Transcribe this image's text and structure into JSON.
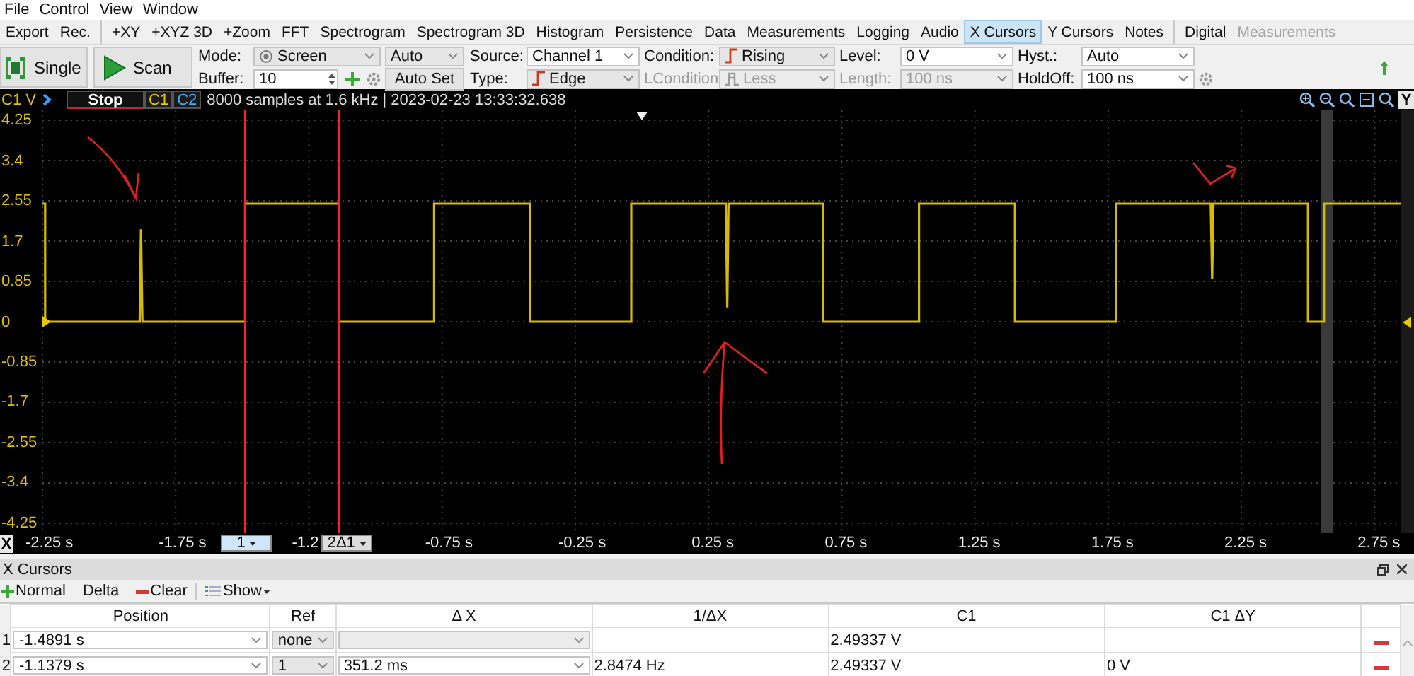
{
  "menu": [
    "File",
    "Control",
    "View",
    "Window"
  ],
  "tab_groups": [
    [
      {
        "label": "Export",
        "selected": false,
        "disabled": false
      },
      {
        "label": "Rec.",
        "selected": false,
        "disabled": false
      }
    ],
    [
      {
        "label": "+XY",
        "selected": false,
        "disabled": false
      },
      {
        "label": "+XYZ 3D",
        "selected": false,
        "disabled": false
      },
      {
        "label": "+Zoom",
        "selected": false,
        "disabled": false
      },
      {
        "label": "FFT",
        "selected": false,
        "disabled": false
      },
      {
        "label": "Spectrogram",
        "selected": false,
        "disabled": false
      },
      {
        "label": "Spectrogram 3D",
        "selected": false,
        "disabled": false
      },
      {
        "label": "Histogram",
        "selected": false,
        "disabled": false
      },
      {
        "label": "Persistence",
        "selected": false,
        "disabled": false
      },
      {
        "label": "Data",
        "selected": false,
        "disabled": false
      },
      {
        "label": "Measurements",
        "selected": false,
        "disabled": false
      },
      {
        "label": "Logging",
        "selected": false,
        "disabled": false
      },
      {
        "label": "Audio",
        "selected": false,
        "disabled": false
      },
      {
        "label": "X Cursors",
        "selected": true,
        "disabled": false
      },
      {
        "label": "Y Cursors",
        "selected": false,
        "disabled": false
      },
      {
        "label": "Notes",
        "selected": false,
        "disabled": false
      }
    ],
    [
      {
        "label": "Digital",
        "selected": false,
        "disabled": false
      },
      {
        "label": "Measurements",
        "selected": false,
        "disabled": true
      }
    ]
  ],
  "toolbar": {
    "single": "Single",
    "scan": "Scan",
    "mode_label": "Mode:",
    "mode": "Screen",
    "mode_option": "Auto",
    "buffer_label": "Buffer:",
    "buffer": "10",
    "auto_set": "Auto Set",
    "trigger": [
      {
        "label": "Source:",
        "value": "Channel 1",
        "kind": "plain",
        "disabled": false
      },
      {
        "label": "Type:",
        "value": "Edge",
        "kind": "edge",
        "disabled": false
      },
      {
        "label": "Condition:",
        "value": "Rising",
        "kind": "edge",
        "disabled": false
      },
      {
        "label": "LCondition",
        "value": "Less",
        "kind": "pulse",
        "disabled": true
      },
      {
        "label": "Level:",
        "value": "0 V",
        "kind": "plain",
        "disabled": false
      },
      {
        "label": "Length:",
        "value": "100 ns",
        "kind": "plain",
        "disabled": true
      },
      {
        "label": "Hyst.:",
        "value": "Auto",
        "kind": "plain",
        "disabled": false
      },
      {
        "label": "HoldOff:",
        "value": "100 ns",
        "kind": "plain",
        "disabled": false
      }
    ]
  },
  "scope": {
    "stop": "Stop",
    "channels": [
      {
        "label": "C1",
        "color": "#e8c800"
      },
      {
        "label": "C2",
        "color": "#3cb0ff"
      }
    ],
    "info": "8000 samples at 1.6 kHz | 2023-02-23 13:33:32.638",
    "y_button": "Y",
    "x_axis_label": "X",
    "chart_data": {
      "type": "line",
      "ylabel": "C1 V",
      "xlim": [
        -2.25,
        2.85
      ],
      "ylim": [
        -4.46,
        4.46
      ],
      "yticks": [
        4.25,
        3.4,
        2.55,
        1.7,
        0.85,
        0,
        -0.85,
        -1.7,
        -2.55,
        -3.4,
        -4.25
      ],
      "xticks": [
        {
          "value": -2.25,
          "label": "-2.25 s"
        },
        {
          "value": -1.75,
          "label": "-1.75 s"
        },
        {
          "value": -1.25,
          "label": "-1.2"
        },
        {
          "value": -0.75,
          "label": "-0.75 s"
        },
        {
          "value": -0.25,
          "label": "-0.25 s"
        },
        {
          "value": 0.25,
          "label": "0.25 s"
        },
        {
          "value": 0.75,
          "label": "0.75 s"
        },
        {
          "value": 1.25,
          "label": "1.25 s"
        },
        {
          "value": 1.75,
          "label": "1.75 s"
        },
        {
          "value": 2.25,
          "label": "2.25 s"
        },
        {
          "value": 2.75,
          "label": "2.75 s"
        }
      ],
      "x": [
        -2.25,
        -2.24,
        -2.24,
        -1.885,
        -1.88,
        -1.875,
        -1.489,
        -1.489,
        -1.138,
        -1.138,
        -0.78,
        -0.78,
        -0.42,
        -0.42,
        -0.04,
        -0.04,
        0.315,
        0.32,
        0.325,
        0.68,
        0.68,
        1.04,
        1.04,
        1.4,
        1.4,
        1.78,
        1.78,
        2.135,
        2.14,
        2.145,
        2.5,
        2.5,
        2.56,
        2.56,
        2.85
      ],
      "series": [
        {
          "color": "#d8b800",
          "values": [
            2.49,
            2.49,
            0,
            0,
            1.95,
            0,
            0,
            2.49,
            2.49,
            0,
            0,
            2.49,
            2.49,
            0,
            0,
            2.49,
            2.49,
            0.3,
            2.49,
            2.49,
            0,
            0,
            2.49,
            2.49,
            0,
            0,
            2.49,
            2.49,
            0.9,
            2.49,
            2.49,
            0,
            0,
            2.49,
            2.49
          ]
        }
      ],
      "grid": true,
      "ref_lines": [
        {
          "axis": "x",
          "value": -1.4891,
          "color": "#ff2020"
        },
        {
          "axis": "x",
          "value": -1.1379,
          "color": "#ff2020"
        }
      ]
    },
    "cursor_handles": [
      {
        "label": "1",
        "selected": true
      },
      {
        "label": "2Δ1",
        "selected": false
      }
    ]
  },
  "cursors_panel": {
    "title": "X Cursors",
    "normal": "Normal",
    "delta": "Delta",
    "clear": "Clear",
    "show": "Show",
    "columns": [
      "Position",
      "Ref",
      "Δ X",
      "1/ΔX",
      "C1",
      "C1 ΔY"
    ],
    "rows": [
      {
        "number": "1",
        "position": "-1.4891 s",
        "ref": "none",
        "delta_x": {
          "disabled": true
        },
        "c1": "2.49337 V"
      },
      {
        "number": "2",
        "position": "-1.1379 s",
        "ref": "1",
        "delta_x": {
          "value": "351.2 ms",
          "disabled": false
        },
        "inverse_delta_x": "2.8474 Hz",
        "c1": "2.49337 V",
        "c1_delta_y": "0 V"
      }
    ]
  }
}
